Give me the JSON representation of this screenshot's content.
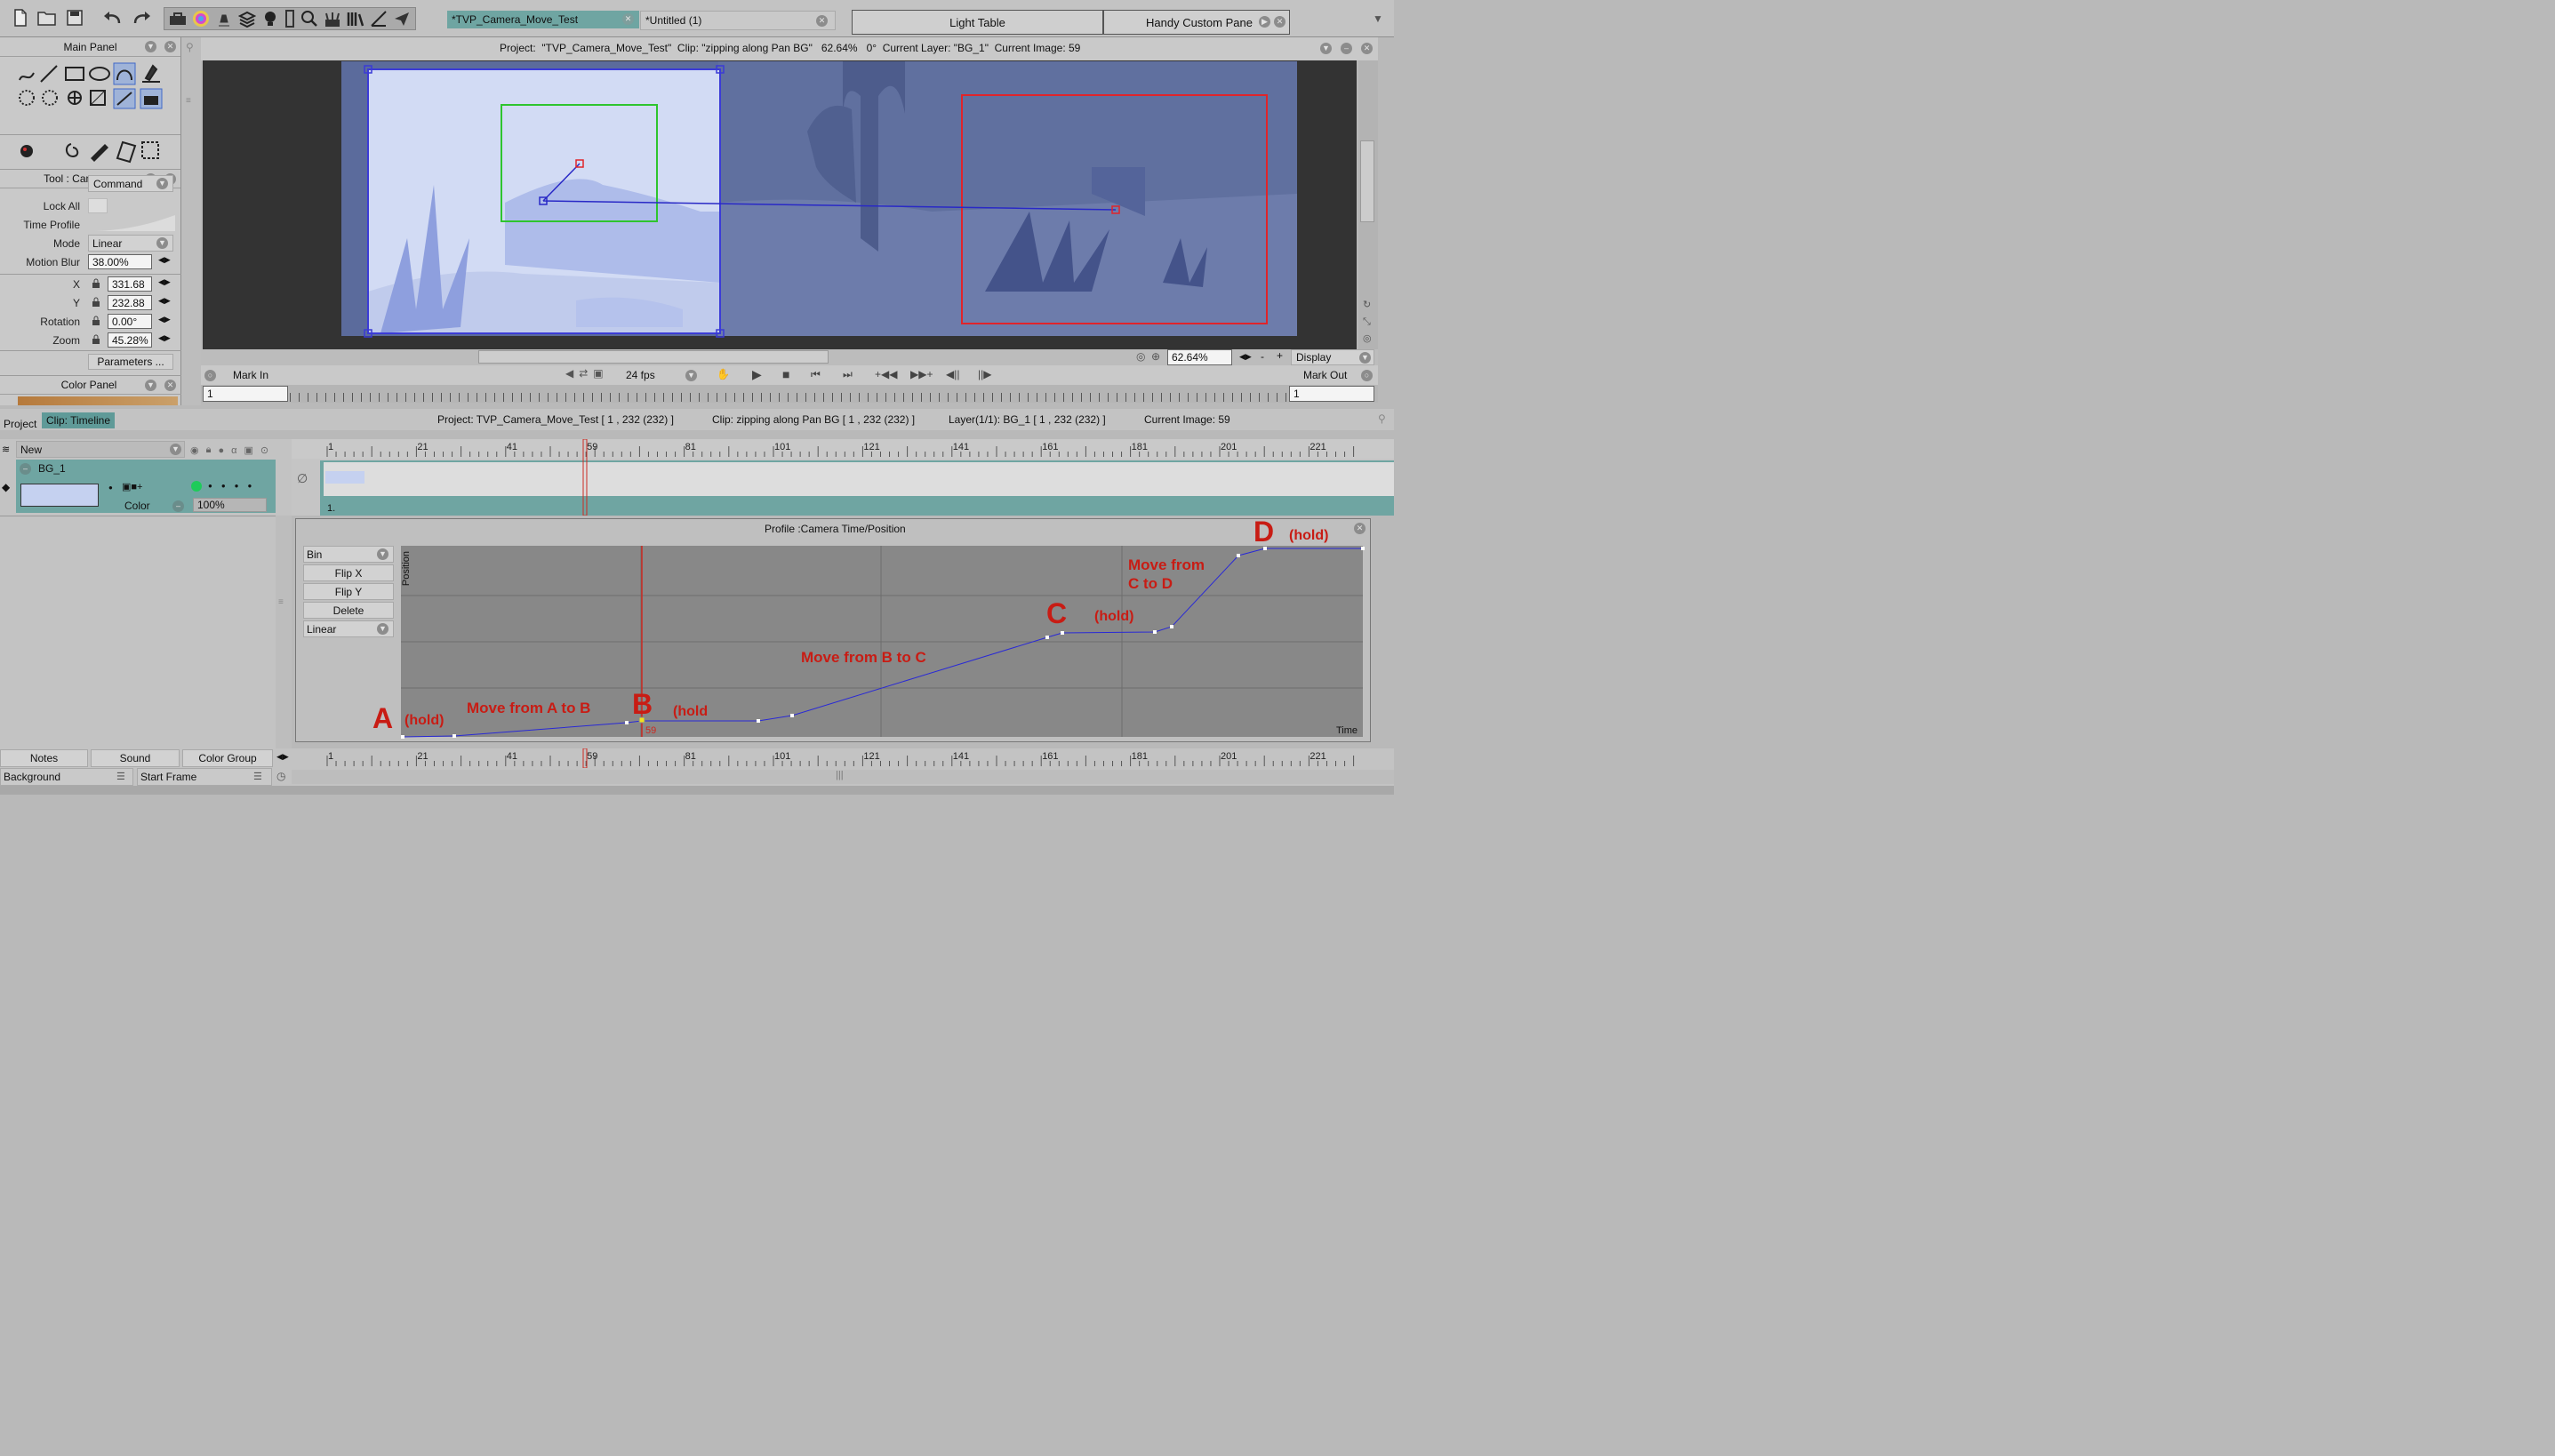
{
  "top_tabs": {
    "doc1": "*TVP_Camera_Move_Test",
    "doc2": "*Untitled (1)",
    "right1": "Light Table",
    "right2": "Handy Custom Pane"
  },
  "main_panel": {
    "title": "Main Panel"
  },
  "tool_panel": {
    "title": "Tool : Camera",
    "command": "Command",
    "lock_all": "Lock All",
    "time_profile": "Time Profile",
    "mode_label": "Mode",
    "mode_value": "Linear",
    "motion_blur_label": "Motion Blur",
    "motion_blur_value": "38.00%",
    "x_label": "X",
    "x_value": "331.68",
    "y_label": "Y",
    "y_value": "232.88",
    "rotation_label": "Rotation",
    "rotation_value": "0.00°",
    "zoom_label": "Zoom",
    "zoom_value": "45.28%",
    "parameters": "Parameters ..."
  },
  "color_panel": {
    "title": "Color Panel"
  },
  "viewport": {
    "status": "Project:  \"TVP_Camera_Move_Test\"  Clip: \"zipping along Pan BG\"   62.64%   0°  Current Layer: \"BG_1\"  Current Image: 59",
    "zoom": "62.64%",
    "display": "Display",
    "zoom_minus": "-",
    "zoom_plus": "+"
  },
  "playback": {
    "mark_in": "Mark In",
    "mark_out": "Mark Out",
    "fps": "24 fps",
    "in_value": "1",
    "out_value": "1"
  },
  "timeline_tabs": {
    "project": "Project",
    "clip": "Clip: Timeline"
  },
  "timeline_info": {
    "project": "Project: TVP_Camera_Move_Test [ 1 , 232  (232) ]",
    "clip": "Clip: zipping along Pan BG [ 1 , 232  (232) ]",
    "layer": "Layer(1/1): BG_1 [ 1 , 232  (232) ]",
    "current": "Current Image: 59"
  },
  "layer_panel": {
    "new": "New",
    "layer_name": "BG_1",
    "color_label": "Color",
    "opacity": "100%"
  },
  "ruler": {
    "ticks": [
      "1",
      "21",
      "41",
      "59",
      "81",
      "101",
      "121",
      "141",
      "161",
      "181",
      "201",
      "221"
    ],
    "frame_label": "1."
  },
  "profile": {
    "title": "Profile :Camera Time/Position",
    "bin": "Bin",
    "flip_x": "Flip X",
    "flip_y": "Flip Y",
    "delete": "Delete",
    "mode": "Linear",
    "y_axis": "Position",
    "x_axis": "Time",
    "marker": "59",
    "annotations": {
      "A": "A",
      "A_hold": "(hold)",
      "AB": "Move from A to B",
      "B": "B",
      "B_hold": "(hold",
      "BC": "Move from B to C",
      "C": "C",
      "C_hold": "(hold)",
      "CD_1": "Move from",
      "CD_2": "C to D",
      "D": "D",
      "D_hold": "(hold)"
    }
  },
  "bottom": {
    "notes": "Notes",
    "sound": "Sound",
    "color_group": "Color Group",
    "background": "Background",
    "start_frame": "Start Frame"
  },
  "colors": {
    "accent_green": "#6fa5a2",
    "tab_active": "#5f9a98",
    "playhead": "#cc2a22",
    "camera_blue": "#3b3bd6",
    "annotation_red": "#c81c14"
  }
}
